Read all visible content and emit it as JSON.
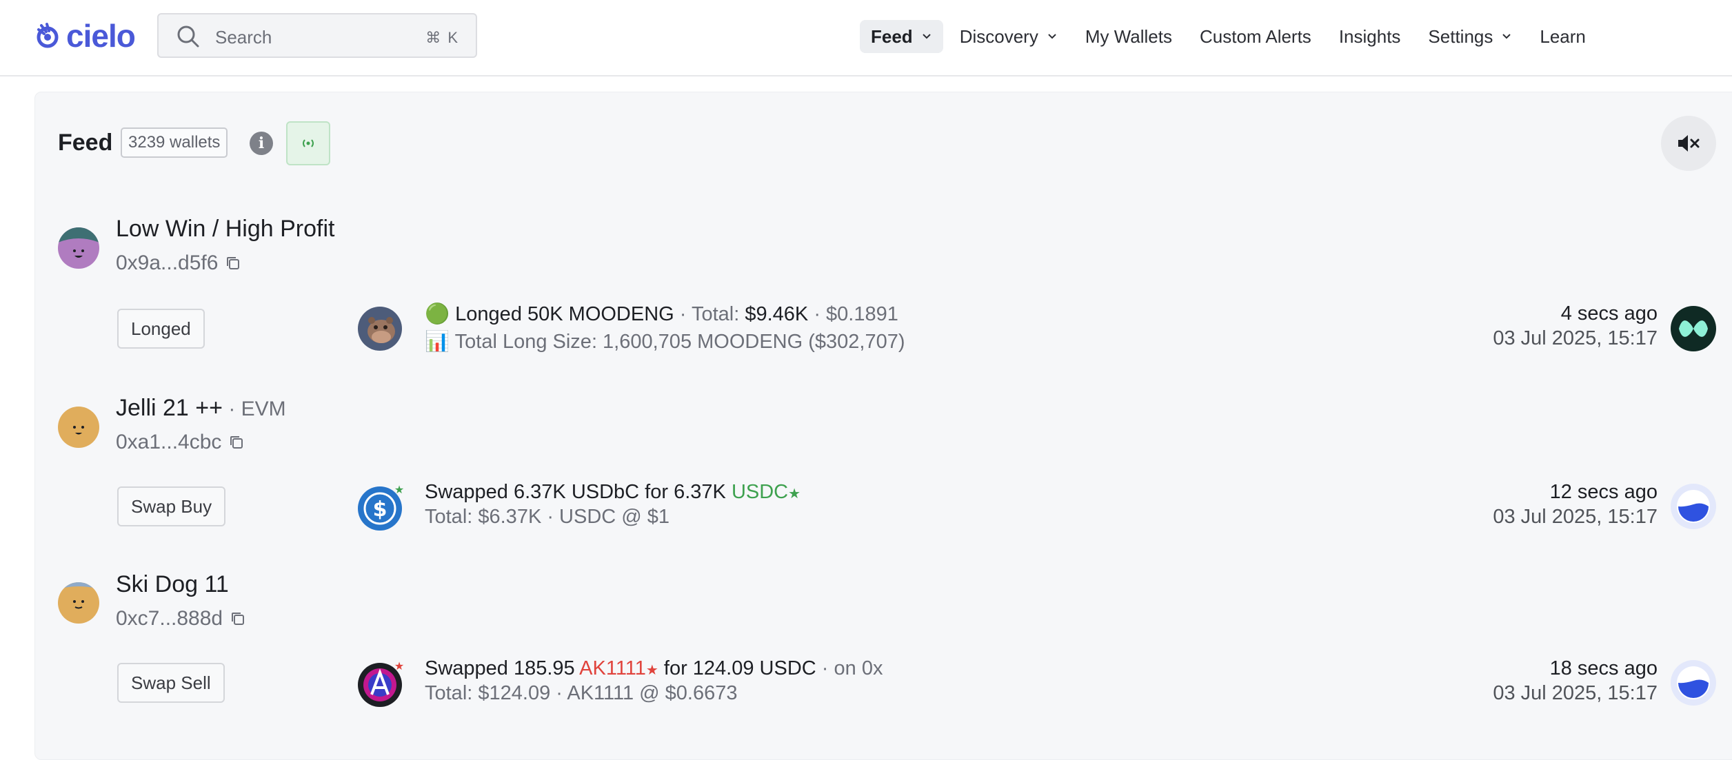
{
  "app": {
    "logo_text": "cielo",
    "icons": {
      "logo": "cielo-swirl-icon",
      "search": "search-icon",
      "chevron": "chevron-down-icon",
      "info": "info-icon",
      "live": "live-signal-icon",
      "mute": "speaker-mute-icon",
      "copy": "copy-icon"
    },
    "colors": {
      "brand": "#4a59d8",
      "positive": "#3ea14f",
      "negative": "#e0433c"
    }
  },
  "search": {
    "placeholder": "Search",
    "shortcut": "⌘ K"
  },
  "nav": {
    "items": [
      {
        "label": "Feed",
        "active": true,
        "has_dropdown": true
      },
      {
        "label": "Discovery",
        "active": false,
        "has_dropdown": true
      },
      {
        "label": "My Wallets",
        "active": false,
        "has_dropdown": false
      },
      {
        "label": "Custom Alerts",
        "active": false,
        "has_dropdown": false
      },
      {
        "label": "Insights",
        "active": false,
        "has_dropdown": false
      },
      {
        "label": "Settings",
        "active": false,
        "has_dropdown": true
      },
      {
        "label": "Learn",
        "active": false,
        "has_dropdown": false
      }
    ]
  },
  "feed": {
    "title": "Feed",
    "wallet_count": "3239 wallets",
    "info_glyph": "i",
    "entries": [
      {
        "wallet_name": "Low Win / High Profit",
        "chain": "",
        "address": "0x9a...d5f6",
        "type": "Longed",
        "line1": {
          "emoji": "🟢",
          "action": "Longed 50K MOODENG",
          "sep1": " · ",
          "total_label": "Total: ",
          "total_value": "$9.46K",
          "sep2": " · ",
          "price": "$0.1891"
        },
        "line2": "📊 Total Long Size: 1,600,705 MOODENG ($302,707)",
        "time_ago": "4 secs ago",
        "date": "03 Jul 2025, 15:17",
        "token_icon": "moodeng-token-icon",
        "platform_icon": "hyperliquid-icon"
      },
      {
        "wallet_name": "Jelli 21 ++",
        "chain": " · EVM",
        "address": "0xa1...4cbc",
        "type": "Swap Buy",
        "line1": {
          "prefix": "Swapped 6.37K USDbC for 6.37K ",
          "token": "USDC",
          "star": "★"
        },
        "line2": "Total: $6.37K · USDC @ $1",
        "time_ago": "12 secs ago",
        "date": "03 Jul 2025, 15:17",
        "token_icon": "usdc-token-icon",
        "platform_icon": "dex-aggregator-icon"
      },
      {
        "wallet_name": "Ski Dog 11",
        "chain": "",
        "address": "0xc7...888d",
        "type": "Swap Sell",
        "line1": {
          "prefix": "Swapped 185.95 ",
          "token": "AK1111",
          "star": "★",
          "suffix": " for 124.09 USDC",
          "venue": " · on 0x"
        },
        "line2": "Total: $124.09 · AK1111 @ $0.6673",
        "time_ago": "18 secs ago",
        "date": "03 Jul 2025, 15:17",
        "token_icon": "ak1111-token-icon",
        "platform_icon": "dex-aggregator-icon"
      }
    ]
  }
}
